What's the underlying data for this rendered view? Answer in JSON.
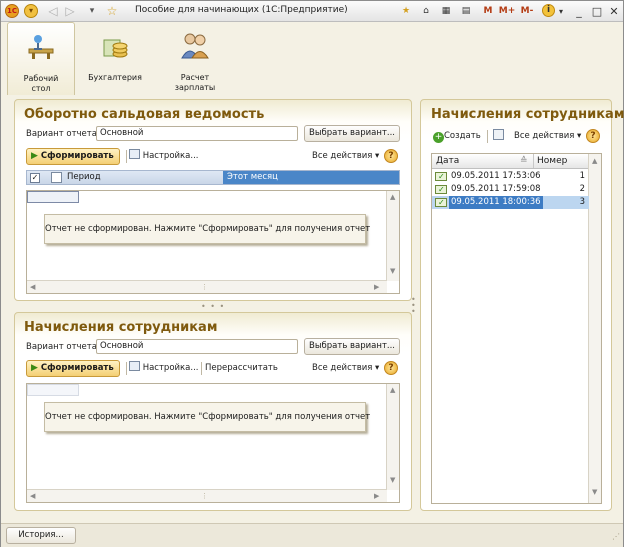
{
  "window": {
    "title": "Пособие для начинающих  (1С:Предприятие)",
    "m_buttons": [
      "M",
      "M+",
      "M-"
    ],
    "info": "i",
    "minimize": "_",
    "maximize": "□",
    "close": "✕"
  },
  "sections": [
    {
      "label_line1": "Рабочий",
      "label_line2": "стол",
      "icon": "desk-icon",
      "active": true
    },
    {
      "label_line1": "Бухгалтерия",
      "label_line2": "",
      "icon": "coins-icon",
      "active": false
    },
    {
      "label_line1": "Расчет",
      "label_line2": "зарплаты",
      "icon": "people-icon",
      "active": false
    }
  ],
  "report1": {
    "title": "Оборотно сальдовая ведомость",
    "variant_label": "Вариант отчета:",
    "variant_value": "Основной",
    "choose_variant": "Выбрать вариант...",
    "generate": "Сформировать",
    "settings": "Настройка...",
    "all_actions": "Все действия",
    "help": "?",
    "param_checked": "✓",
    "param_name": "Период",
    "param_value": "Этот месяц",
    "message": "Отчет не сформирован. Нажмите \"Сформировать\" для получения отчет"
  },
  "report2": {
    "title": "Начисления сотрудникам",
    "variant_label": "Вариант отчета:",
    "variant_value": "Основной",
    "choose_variant": "Выбрать вариант...",
    "generate": "Сформировать",
    "settings": "Настройка...",
    "recalc": "Перерассчитать",
    "all_actions": "Все действия",
    "help": "?",
    "message": "Отчет не сформирован. Нажмите \"Сформировать\" для получения отчет"
  },
  "list": {
    "title": "Начисления сотрудникам",
    "create": "Создать",
    "all_actions": "Все действия",
    "help": "?",
    "columns": [
      "Дата",
      "Номер"
    ],
    "rows": [
      {
        "date": "09.05.2011 17:53:06",
        "number": "1",
        "selected": false
      },
      {
        "date": "09.05.2011 17:59:08",
        "number": "2",
        "selected": false
      },
      {
        "date": "09.05.2011 18:00:36",
        "number": "3",
        "selected": true
      }
    ]
  },
  "status": {
    "history": "История..."
  },
  "colors": {
    "title_accent": "#7f5a0e",
    "selection": "#4a86c8",
    "gold_button": "#f4cf74"
  }
}
